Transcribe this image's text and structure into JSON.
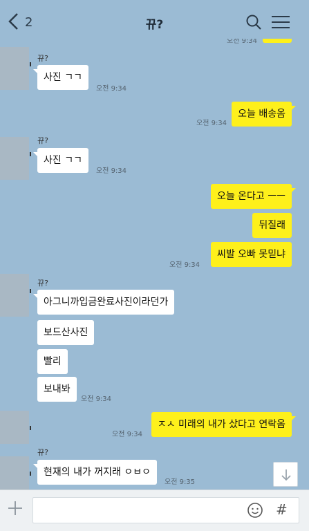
{
  "header": {
    "back_count": "2",
    "title": "뀨?"
  },
  "chat": {
    "name": "뀨?",
    "top_time": "오전 9:34",
    "messages": [
      {
        "text": "사진 ㄱㄱ",
        "time": "오전 9:34"
      },
      {
        "text": "오늘 배송옴",
        "time": "오전 9:34"
      },
      {
        "text": "사진 ㄱㄱ",
        "time": "오전 9:34"
      },
      {
        "text": "오늘 온다고 ㅡㅡ"
      },
      {
        "text": "뒤질래"
      },
      {
        "text": "씨발 오빠 못믿냐",
        "time": "오전 9:34"
      },
      {
        "text": "아그니까입금완료사진이라던가"
      },
      {
        "text": "보드산사진"
      },
      {
        "text": "빨리"
      },
      {
        "text": "보내봐",
        "time": "오전 9:34"
      },
      {
        "text": "ㅈㅅ 미래의 내가 샀다고 연락옴",
        "time": "오전 9:34"
      },
      {
        "text": "현재의 내가 꺼지래 ㅇㅂㅇ",
        "time": "오전 9:35"
      }
    ]
  },
  "composer": {
    "input_value": "",
    "hash_label": "#"
  },
  "colors": {
    "background": "#9bbbd4",
    "outgoing_bubble": "#fef01b",
    "incoming_bubble": "#ffffff"
  }
}
